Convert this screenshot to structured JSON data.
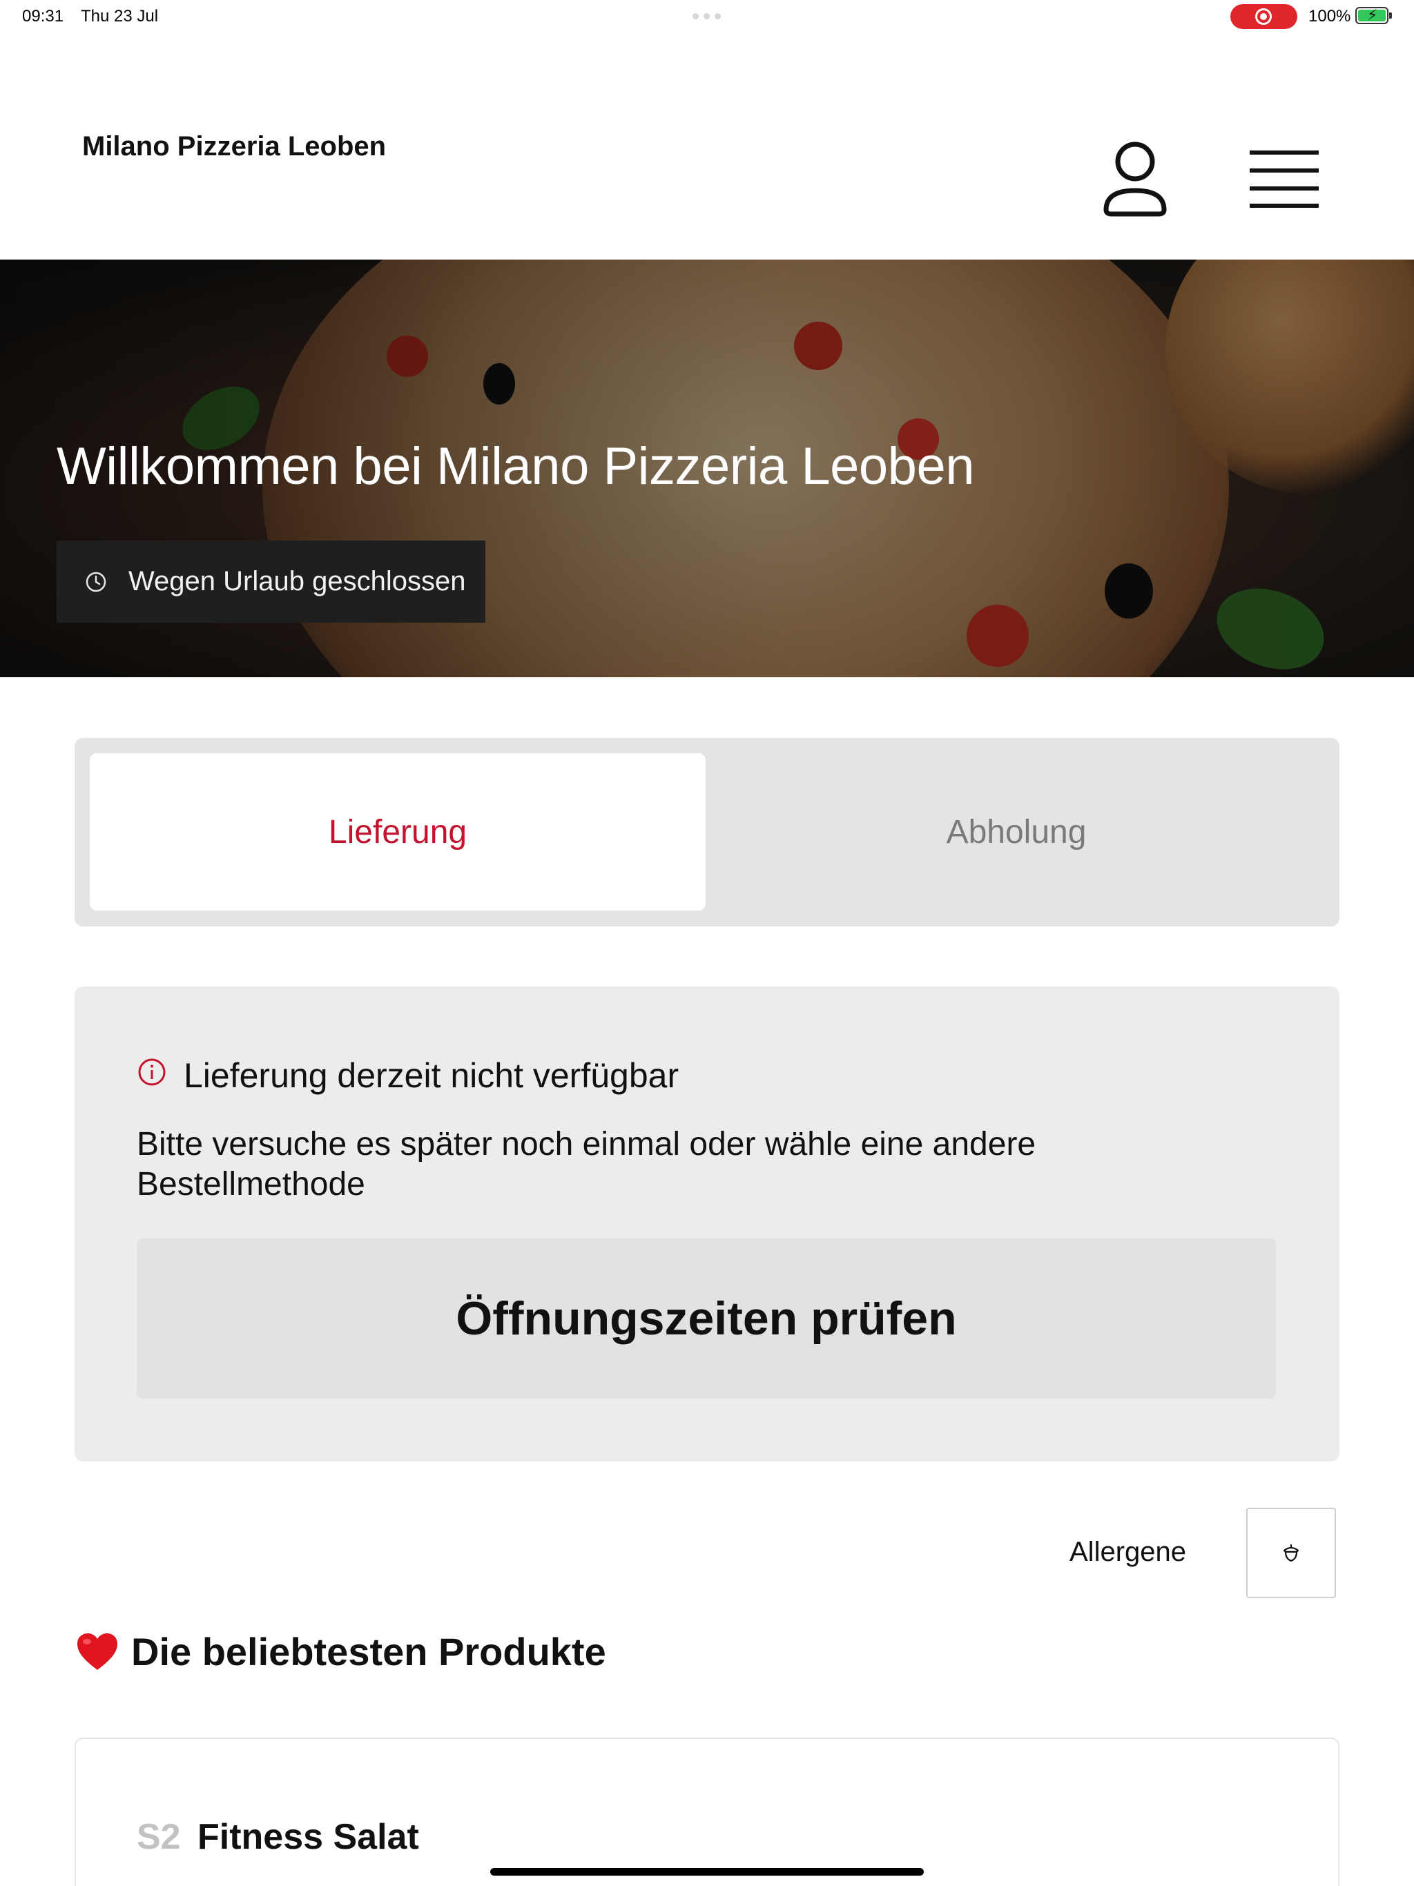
{
  "status_bar": {
    "time": "09:31",
    "date": "Thu 23 Jul",
    "battery": "100%"
  },
  "header": {
    "brand": "Milano Pizzeria Leoben",
    "icons": [
      "user-icon",
      "menu-icon"
    ]
  },
  "hero": {
    "title": "Willkommen bei Milano Pizzeria Leoben",
    "status": "Wegen Urlaub geschlossen"
  },
  "tabs": [
    {
      "label": "Lieferung",
      "active": true
    },
    {
      "label": "Abholung",
      "active": false
    }
  ],
  "notice": {
    "heading": "Lieferung derzeit nicht verfügbar",
    "body": "Bitte versuche es später noch einmal oder wähle eine andere Bestellmethode",
    "button": "Öffnungszeiten prüfen"
  },
  "allergens": {
    "label": "Allergene"
  },
  "popular": {
    "heading": "Die beliebtesten Produkte"
  },
  "products": [
    {
      "code": "S2",
      "name": "Fitness Salat"
    }
  ],
  "colors": {
    "accent": "#c4122f",
    "recording": "#e0262b",
    "panel": "#ececec"
  }
}
